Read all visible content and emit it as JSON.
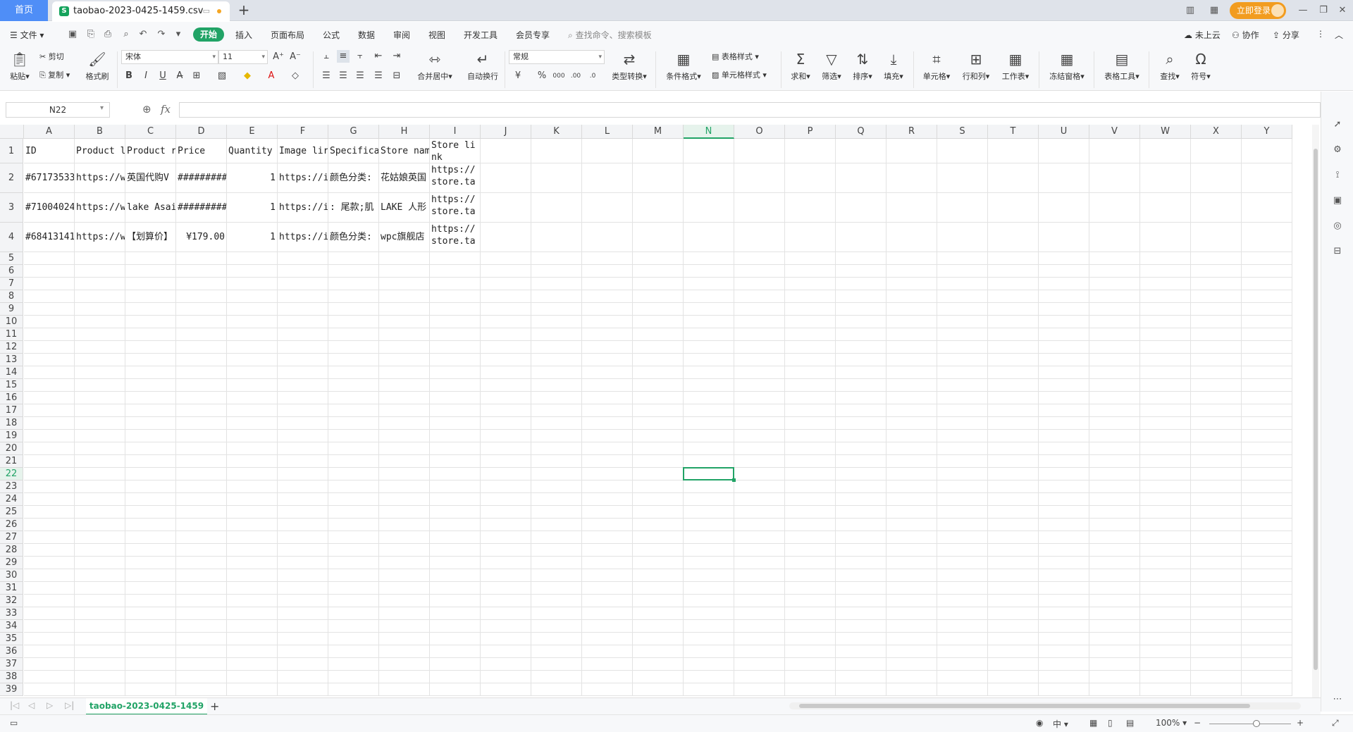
{
  "titlebar": {
    "home_tab": "首页",
    "file_tab": "taobao-2023-0425-1459.csv",
    "login_button": "立即登录"
  },
  "menubar": {
    "file_menu": "文件",
    "tabs": [
      "开始",
      "插入",
      "页面布局",
      "公式",
      "数据",
      "审阅",
      "视图",
      "开发工具",
      "会员专享"
    ],
    "search_placeholder": "查找命令、搜索模板",
    "cloud": "未上云",
    "collab": "协作",
    "share": "分享"
  },
  "ribbon": {
    "paste": "粘贴",
    "cut": "剪切",
    "copy": "复制",
    "format_painter": "格式刷",
    "font_name": "宋体",
    "font_size": "11",
    "merge_center": "合并居中",
    "wrap_text": "自动换行",
    "number_format": "常规",
    "type_convert": "类型转换",
    "conditional_format": "条件格式",
    "table_style": "表格样式",
    "cell_style": "单元格样式",
    "sum": "求和",
    "filter": "筛选",
    "sort": "排序",
    "fill": "填充",
    "cell": "单元格",
    "row_col": "行和列",
    "worksheet": "工作表",
    "freeze": "冻结窗格",
    "table_tools": "表格工具",
    "find": "查找",
    "symbol": "符号"
  },
  "formula_bar": {
    "name_box": "N22",
    "fx": "fx",
    "value": ""
  },
  "sheet": {
    "columns": [
      "A",
      "B",
      "C",
      "D",
      "E",
      "F",
      "G",
      "H",
      "I",
      "J",
      "K",
      "L",
      "M",
      "N",
      "O",
      "P",
      "Q",
      "R",
      "S",
      "T",
      "U",
      "V",
      "W",
      "X",
      "Y"
    ],
    "selected_column": "N",
    "selected_row": 22,
    "row_count": 39,
    "rows": [
      [
        "ID",
        "Product l",
        "Product r",
        "Price",
        "Quantity",
        "Image lir",
        "Specifica",
        "Store nam",
        "Store link"
      ],
      [
        "#67173533",
        "https://w",
        "英国代购V",
        "#########",
        "1",
        "https://i",
        "颜色分类:",
        "花姑娘英国",
        "https://store.ta"
      ],
      [
        "#71004024",
        "https://w",
        "lake Asai",
        "#########",
        "1",
        "https://i1",
        ": 尾款;肌",
        "LAKE 人形",
        "https://store.ta"
      ],
      [
        "#68413141",
        "https://w",
        "【划算价】",
        "¥179.00",
        "1",
        "https://i",
        "颜色分类:",
        "wpc旗舰店",
        "https://store.ta"
      ]
    ]
  },
  "sheet_tab": "taobao-2023-0425-1459",
  "status": {
    "zoom": "100%"
  }
}
